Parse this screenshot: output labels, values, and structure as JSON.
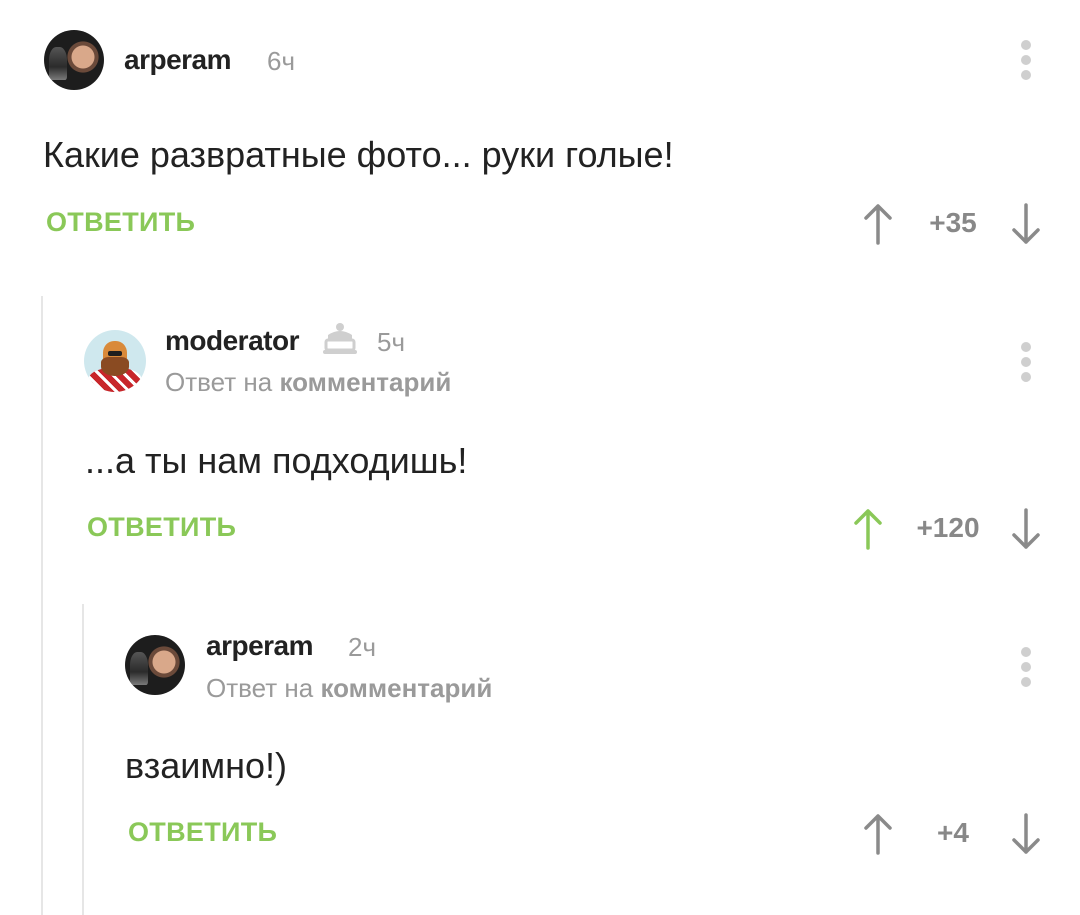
{
  "comments": [
    {
      "username": "arperam",
      "time": "6ч",
      "text": "Какие развратные фото... руки голые!",
      "reply_label": "ОТВЕТИТЬ",
      "rating": "+35",
      "upvoted": false
    },
    {
      "username": "moderator",
      "time": "5ч",
      "reply_to_prefix": "Ответ на",
      "reply_to_link": "комментарий",
      "text": "...а ты нам подходишь!",
      "reply_label": "ОТВЕТИТЬ",
      "rating": "+120",
      "upvoted": true,
      "badge_icon": "moderator-cake-icon"
    },
    {
      "username": "arperam",
      "time": "2ч",
      "reply_to_prefix": "Ответ на",
      "reply_to_link": "комментарий",
      "text": "взаимно!)",
      "reply_label": "ОТВЕТИТЬ",
      "rating": "+4",
      "upvoted": false
    }
  ],
  "colors": {
    "accent_green": "#8ac858",
    "text_dark": "#222222",
    "text_muted": "#9a9a9a",
    "arrow_gray": "#888888",
    "thread_line": "#e6e6e6"
  },
  "icons": {
    "upvote": "arrow-up-icon",
    "downvote": "arrow-down-icon",
    "more": "more-vertical-icon"
  }
}
